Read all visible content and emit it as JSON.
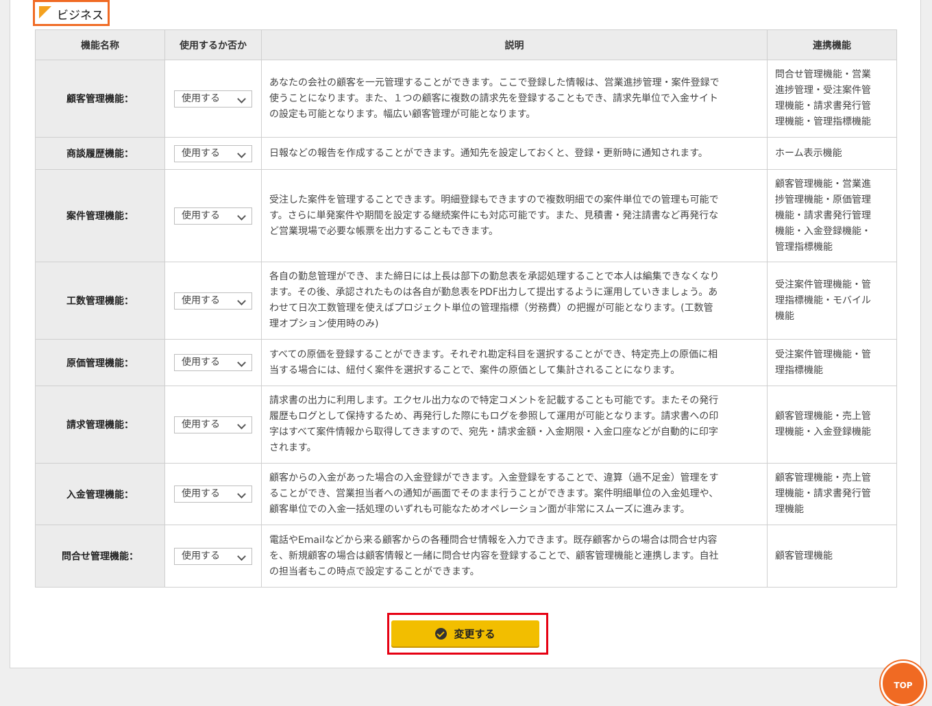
{
  "section": {
    "title": "ビジネス"
  },
  "table": {
    "headers": [
      "機能名称",
      "使用するか否か",
      "説明",
      "連携機能"
    ],
    "rows": [
      {
        "name": "顧客管理機能：",
        "use": "使用する",
        "desc": [
          "あなたの会社の顧客を一元管理することができます。ここで登録した情報は、営業進捗管理・案件登録で",
          "使うことになります。また、１つの顧客に複数の請求先を登録することもでき、請求先単位で入金サイト",
          "の設定も可能となります。幅広い顧客管理が可能となります。"
        ],
        "link": [
          "問合せ管理機能・営業",
          "進捗管理・受注案件管",
          "理機能・請求書発行管",
          "理機能・管理指標機能"
        ]
      },
      {
        "name": "商談履歴機能：",
        "use": "使用する",
        "desc": [
          "日報などの報告を作成することができます。通知先を設定しておくと、登録・更新時に通知されます。"
        ],
        "link": [
          "ホーム表示機能"
        ]
      },
      {
        "name": "案件管理機能：",
        "use": "使用する",
        "desc": [
          "受注した案件を管理することできます。明細登録もできますので複数明細での案件単位での管理も可能で",
          "す。さらに単発案件や期間を設定する継続案件にも対応可能です。また、見積書・発注請書など再発行な",
          "ど営業現場で必要な帳票を出力することもできます。"
        ],
        "link": [
          "顧客管理機能・営業進",
          "捗管理機能・原価管理",
          "機能・請求書発行管理",
          "機能・入金登録機能・",
          "管理指標機能"
        ]
      },
      {
        "name": "工数管理機能：",
        "use": "使用する",
        "desc": [
          "各自の勤怠管理ができ、また締日には上長は部下の勤怠表を承認処理することで本人は編集できなくなり",
          "ます。その後、承認されたものは各自が勤怠表をPDF出力して提出するように運用していきましょう。あ",
          "わせて日次工数管理を使えばプロジェクト単位の管理指標（労務費）の把握が可能となります。(工数管",
          "理オプション使用時のみ)"
        ],
        "link": [
          "受注案件管理機能・管",
          "理指標機能・モバイル",
          "機能"
        ]
      },
      {
        "name": "原価管理機能：",
        "use": "使用する",
        "desc": [
          "すべての原価を登録することができます。それぞれ勘定科目を選択することができ、特定売上の原価に相",
          "当する場合には、紐付く案件を選択することで、案件の原価として集計されることになります。"
        ],
        "link": [
          "受注案件管理機能・管",
          "理指標機能"
        ]
      },
      {
        "name": "請求管理機能：",
        "use": "使用する",
        "desc": [
          "請求書の出力に利用します。エクセル出力なので特定コメントを記載することも可能です。またその発行",
          "履歴もログとして保持するため、再発行した際にもログを参照して運用が可能となります。請求書への印",
          "字はすべて案件情報から取得してきますので、宛先・請求金額・入金期限・入金口座などが自動的に印字",
          "されます。"
        ],
        "link": [
          "顧客管理機能・売上管",
          "理機能・入金登録機能"
        ]
      },
      {
        "name": "入金管理機能：",
        "use": "使用する",
        "desc": [
          "顧客からの入金があった場合の入金登録ができます。入金登録をすることで、違算（過不足金）管理をす",
          "ることができ、営業担当者への通知が画面でそのまま行うことができます。案件明細単位の入金処理や、",
          "顧客単位での入金一括処理のいずれも可能なためオペレーション面が非常にスムーズに進みます。"
        ],
        "link": [
          "顧客管理機能・売上管",
          "理機能・請求書発行管",
          "理機能"
        ]
      },
      {
        "name": "問合せ管理機能：",
        "use": "使用する",
        "desc": [
          "電話やEmailなどから来る顧客からの各種問合せ情報を入力できます。既存顧客からの場合は問合せ内容",
          "を、新規顧客の場合は顧客情報と一緒に問合せ内容を登録することで、顧客管理機能と連携します。自社",
          "の担当者もこの時点で設定することができます。"
        ],
        "link": [
          "顧客管理機能"
        ]
      }
    ]
  },
  "submit": {
    "label": "変更する"
  },
  "top_button": {
    "label": "TOP"
  }
}
